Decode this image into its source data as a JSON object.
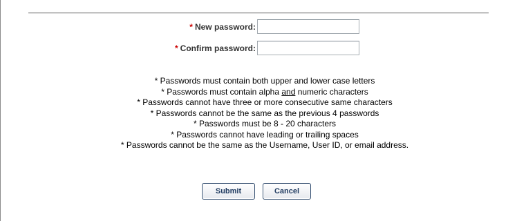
{
  "form": {
    "required_marker": "*",
    "new_password": {
      "label": "New password:",
      "value": ""
    },
    "confirm_password": {
      "label": "Confirm password:",
      "value": ""
    }
  },
  "rules": {
    "r1": "* Passwords must contain both upper and lower case letters",
    "r2_before": "* Passwords must contain alpha ",
    "r2_underlined": "and",
    "r2_after": " numeric characters",
    "r3": "* Passwords cannot have three or more consecutive same characters",
    "r4": "* Passwords cannot be the same as the previous 4 passwords",
    "r5": "* Passwords must be 8 - 20 characters",
    "r6": "* Passwords cannot have leading or trailing spaces",
    "r7": "* Passwords cannot be the same as the Username, User ID, or email address."
  },
  "buttons": {
    "submit_label": "Submit",
    "cancel_label": "Cancel"
  }
}
